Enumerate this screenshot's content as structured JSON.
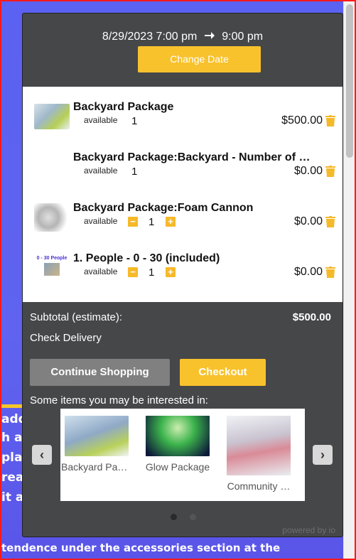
{
  "background": {
    "lines": [
      "add",
      "h as",
      "pla",
      "reat",
      "it ar"
    ],
    "bottom_text": "tendence under the accessories section at the"
  },
  "cart": {
    "date_start": "8/29/2023 7:00 pm",
    "date_end": "9:00 pm",
    "change_date_label": "Change Date",
    "items": [
      {
        "name": "Backyard Package",
        "availability": "available",
        "quantity": "1",
        "price": "$500.00",
        "has_stepper": false,
        "thumb": "photo"
      },
      {
        "name": "Backyard Package:Backyard - Number of …",
        "availability": "available",
        "quantity": "1",
        "price": "$0.00",
        "has_stepper": false,
        "thumb": "none"
      },
      {
        "name": "Backyard Package:Foam Cannon",
        "availability": "available",
        "quantity": "1",
        "price": "$0.00",
        "has_stepper": true,
        "thumb": "foam"
      },
      {
        "name": "1. People - 0 - 30 (included)",
        "availability": "available",
        "quantity": "1",
        "price": "$0.00",
        "has_stepper": true,
        "thumb": "people",
        "thumb_text": "0 - 30 People"
      }
    ],
    "subtotal_label": "Subtotal (estimate):",
    "subtotal_value": "$500.00",
    "check_delivery_label": "Check Delivery",
    "continue_label": "Continue Shopping",
    "checkout_label": "Checkout",
    "suggest_heading": "Some items you may be interested in:",
    "suggestions": [
      {
        "name": "Backyard Pac…"
      },
      {
        "name": "Glow Package"
      },
      {
        "name": "Community …"
      }
    ],
    "powered_by": "powered by io"
  },
  "colors": {
    "accent": "#f8c22d",
    "panel": "#454749",
    "background": "#5b61f0"
  }
}
